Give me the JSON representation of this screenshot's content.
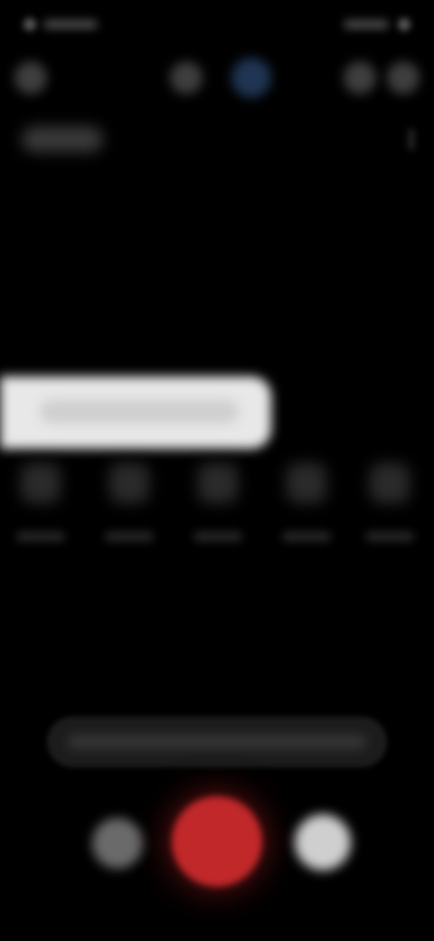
{
  "colors": {
    "background": "#000000",
    "shutter": "#c0282a",
    "banner": "#e8e8e8",
    "accent_control": "#1f3553"
  },
  "status_bar": {
    "left_icons": [
      "status-dot",
      "status-bar"
    ],
    "right_icons": [
      "status-bar",
      "battery"
    ]
  },
  "top_controls": [
    {
      "name": "settings-icon"
    },
    {
      "name": "flash-icon"
    },
    {
      "name": "hdr-icon"
    },
    {
      "name": "timer-icon"
    },
    {
      "name": "aspect-ratio-icon"
    }
  ],
  "info_row": {
    "left_icon": "info-icon",
    "right_icon": "more-icon"
  },
  "banner": {
    "icon": "banner-icon"
  },
  "modes": [
    {
      "icon": "mode-icon"
    },
    {
      "icon": "mode-icon"
    },
    {
      "icon": "mode-icon"
    },
    {
      "icon": "mode-icon"
    },
    {
      "icon": "mode-icon"
    }
  ],
  "zoom": {
    "icon": "zoom-slider"
  },
  "shutter_row": {
    "gallery_icon": "gallery-thumbnail-icon",
    "shutter_icon": "record-icon",
    "switch_icon": "camera-switch-icon"
  }
}
